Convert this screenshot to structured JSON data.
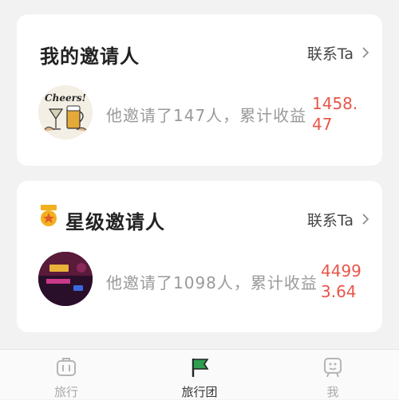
{
  "card_inviter": {
    "title": "我的邀请人",
    "contact": "联系Ta",
    "desc": "他邀请了147人，累计收益",
    "amount": "1458.47",
    "avatar_text": "Cheers!"
  },
  "card_star": {
    "title": "星级邀请人",
    "contact": "联系Ta",
    "desc": "他邀请了1098人，累计收益",
    "amount": "44993.64"
  },
  "nav": {
    "items": [
      {
        "label": "旅行",
        "icon": "suitcase-icon",
        "active": false
      },
      {
        "label": "旅行团",
        "icon": "flag-icon",
        "active": true
      },
      {
        "label": "我",
        "icon": "profile-icon",
        "active": false
      }
    ]
  },
  "colors": {
    "amount": "#e8564a",
    "active_icon": "#2e9e4f",
    "medal": "#f2b01e"
  }
}
